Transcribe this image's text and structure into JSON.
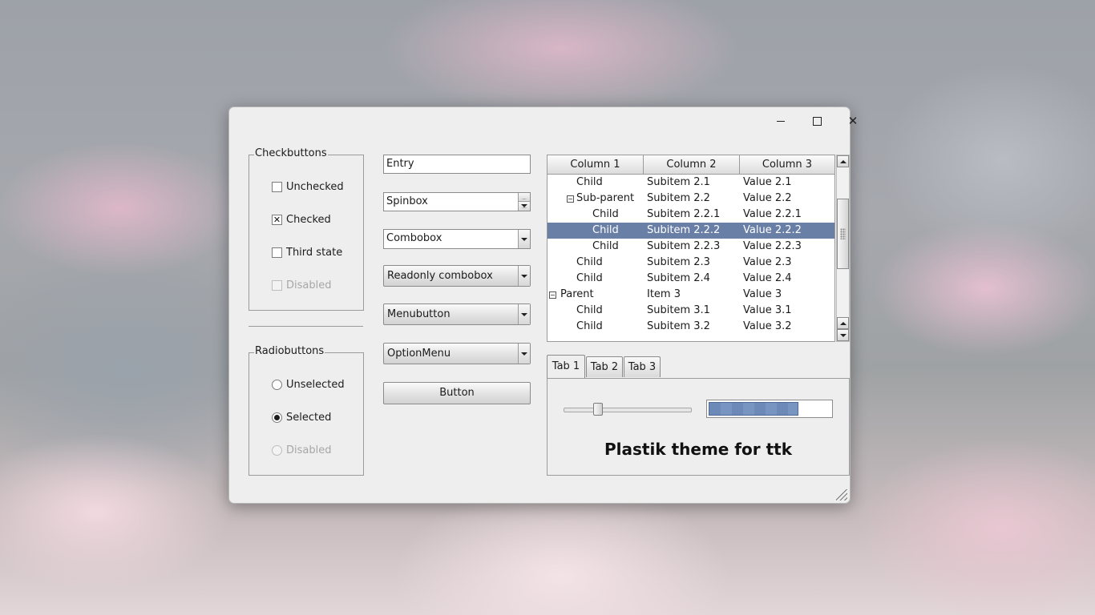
{
  "window": {
    "controls": {
      "minimize_icon": "minimize-icon",
      "maximize_icon": "maximize-icon",
      "close_icon": "close-icon"
    }
  },
  "checkbuttons": {
    "title": "Checkbuttons",
    "items": [
      {
        "label": "Unchecked",
        "state": "unchecked"
      },
      {
        "label": "Checked",
        "state": "checked"
      },
      {
        "label": "Third state",
        "state": "unchecked"
      },
      {
        "label": "Disabled",
        "state": "disabled"
      }
    ]
  },
  "radiobuttons": {
    "title": "Radiobuttons",
    "items": [
      {
        "label": "Unselected",
        "state": "unselected"
      },
      {
        "label": "Selected",
        "state": "selected"
      },
      {
        "label": "Disabled",
        "state": "disabled"
      }
    ]
  },
  "widgets": {
    "entry_value": "Entry",
    "spinbox_value": "Spinbox",
    "combobox_value": "Combobox",
    "readonly_combobox_value": "Readonly combobox",
    "menubutton_label": "Menubutton",
    "optionmenu_label": "OptionMenu",
    "button_label": "Button"
  },
  "treeview": {
    "columns": [
      "Column 1",
      "Column 2",
      "Column 3"
    ],
    "rows": [
      {
        "c1": "Child",
        "c2": "Subitem 2.1",
        "c3": "Value 2.1",
        "indent": 1,
        "expander": "",
        "selected": false
      },
      {
        "c1": "Sub-parent",
        "c2": "Subitem 2.2",
        "c3": "Value 2.2",
        "indent": 1,
        "expander": "⊟",
        "selected": false
      },
      {
        "c1": "Child",
        "c2": "Subitem 2.2.1",
        "c3": "Value 2.2.1",
        "indent": 2,
        "expander": "",
        "selected": false
      },
      {
        "c1": "Child",
        "c2": "Subitem 2.2.2",
        "c3": "Value 2.2.2",
        "indent": 2,
        "expander": "",
        "selected": true
      },
      {
        "c1": "Child",
        "c2": "Subitem 2.2.3",
        "c3": "Value 2.2.3",
        "indent": 2,
        "expander": "",
        "selected": false
      },
      {
        "c1": "Child",
        "c2": "Subitem 2.3",
        "c3": "Value 2.3",
        "indent": 1,
        "expander": "",
        "selected": false
      },
      {
        "c1": "Child",
        "c2": "Subitem 2.4",
        "c3": "Value 2.4",
        "indent": 1,
        "expander": "",
        "selected": false
      },
      {
        "c1": "Parent",
        "c2": "Item 3",
        "c3": "Value 3",
        "indent": 0,
        "expander": "⊟",
        "selected": false
      },
      {
        "c1": "Child",
        "c2": "Subitem 3.1",
        "c3": "Value 3.1",
        "indent": 1,
        "expander": "",
        "selected": false
      },
      {
        "c1": "Child",
        "c2": "Subitem 3.2",
        "c3": "Value 3.2",
        "indent": 1,
        "expander": "",
        "selected": false
      }
    ]
  },
  "notebook": {
    "tabs": [
      "Tab 1",
      "Tab 2",
      "Tab 3"
    ],
    "active_tab": 0,
    "scale_value": 0.25,
    "progress_value": 0.74,
    "banner_text": "Plastik theme for ttk"
  },
  "colors": {
    "selection": "#6a7fa6",
    "progress": "#6c89b8",
    "window_bg": "#eeeeee"
  }
}
